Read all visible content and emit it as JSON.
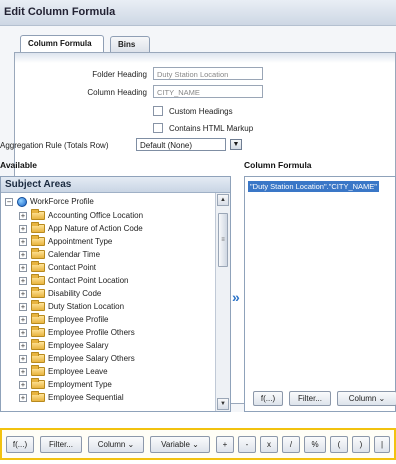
{
  "dialog": {
    "title": "Edit Column Formula",
    "tabs": [
      {
        "label": "Column Formula",
        "active": true
      },
      {
        "label": "Bins",
        "active": false
      }
    ]
  },
  "form": {
    "folder_heading_label": "Folder Heading",
    "folder_heading_value": "Duty Station Location",
    "column_heading_label": "Column Heading",
    "column_heading_value": "CITY_NAME",
    "custom_headings_label": "Custom Headings",
    "contains_html_label": "Contains HTML Markup",
    "aggregation_label": "Aggregation Rule (Totals Row)",
    "aggregation_value": "Default (None)"
  },
  "available": {
    "section_label": "Available",
    "tree_title": "Subject Areas",
    "root": "WorkForce Profile",
    "items": [
      "Accounting Office Location",
      "App Nature of Action Code",
      "Appointment Type",
      "Calendar Time",
      "Contact Point",
      "Contact Point Location",
      "Disability Code",
      "Duty Station Location",
      "Employee Profile",
      "Employee Profile Others",
      "Employee Salary",
      "Employee Salary Others",
      "Employee Leave",
      "Employment Type",
      "Employee Sequential"
    ]
  },
  "formula_box": {
    "section_label": "Column Formula",
    "text": "\"Duty Station Location\".\"CITY_NAME\"",
    "buttons": {
      "f": "f(...)",
      "filter": "Filter...",
      "column": "Column ⌄"
    }
  },
  "toolbar": {
    "buttons": [
      "f(...)",
      "Filter...",
      "Column ⌄",
      "Variable ⌄",
      "+",
      "-",
      "x",
      "/",
      "%",
      "(",
      ")",
      "|"
    ]
  },
  "colors": {
    "highlight_border": "#f2c20f",
    "selection": "#3a77c7",
    "move_arrow": "#2b73c8"
  }
}
